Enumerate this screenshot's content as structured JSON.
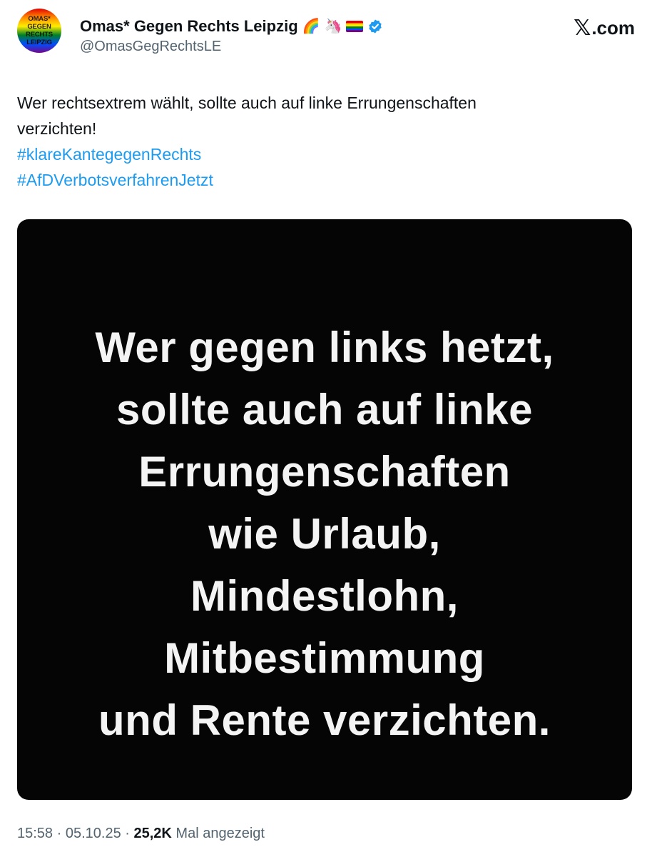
{
  "account": {
    "avatar_lines": [
      "OMAS*",
      "GEGEN",
      "RECHTS",
      "LEIPZIG"
    ],
    "display_name": "Omas* Gegen Rechts Leipzig",
    "emojis": [
      "🌈",
      "🦄"
    ],
    "handle": "@OmasGegRechtsLE"
  },
  "brand": {
    "x_glyph": "𝕏",
    "domain": ".com"
  },
  "tweet": {
    "text_lines": [
      "Wer rechtsextrem wählt, sollte auch auf linke Errungenschaften",
      "verzichten!"
    ],
    "hashtags": [
      "#klareKantegegenRechts",
      "#AfDVerbotsverfahrenJetzt"
    ]
  },
  "media": {
    "lines": [
      "Wer gegen links hetzt,",
      "sollte auch auf linke",
      "Errungenschaften",
      "wie Urlaub,",
      "Mindestlohn,",
      "Mitbestimmung",
      "und Rente verzichten."
    ]
  },
  "meta": {
    "time": "15:58",
    "sep1": " · ",
    "date": "05.10.25",
    "sep2": " · ",
    "views": "25,2K",
    "views_label": " Mal angezeigt"
  },
  "colors": {
    "link": "#1d9bf0",
    "verified": "#1d9bf0",
    "secondary_text": "#536471",
    "media_bg": "#050505"
  }
}
